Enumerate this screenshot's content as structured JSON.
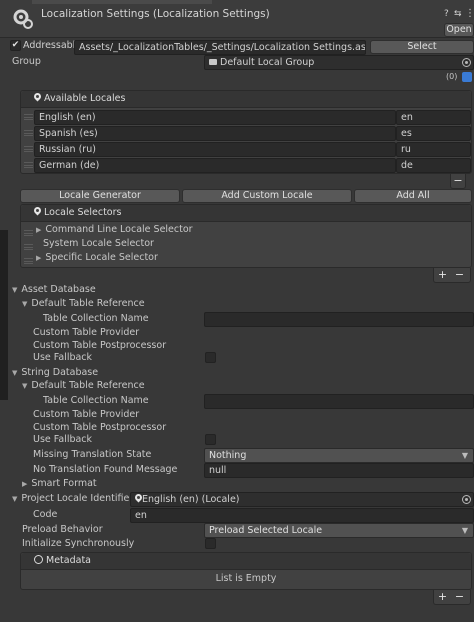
{
  "header": {
    "title": "Localization Settings (Localization Settings)",
    "open_button": "Open",
    "help_icon": "?",
    "preset_icon": "⇆",
    "menu_icon": "⋮"
  },
  "addressable": {
    "checkbox_label": "Addressable",
    "checked": true,
    "path": "Assets/_LocalizationTables/_Settings/Localization Settings.asset",
    "select_button": "Select"
  },
  "group": {
    "label": "Group",
    "value": "Default Local Group",
    "labels_count": "(0)"
  },
  "available_locales": {
    "title": "Available Locales",
    "items": [
      {
        "name": "English (en)",
        "code": "en"
      },
      {
        "name": "Spanish (es)",
        "code": "es"
      },
      {
        "name": "Russian (ru)",
        "code": "ru"
      },
      {
        "name": "German (de)",
        "code": "de"
      }
    ],
    "minus": "−"
  },
  "locale_buttons": {
    "generator": "Locale Generator",
    "add_custom": "Add Custom Locale",
    "add_all": "Add All"
  },
  "locale_selectors": {
    "title": "Locale Selectors",
    "items": [
      {
        "label": "Command Line Locale Selector",
        "foldout": true
      },
      {
        "label": "System Locale Selector",
        "foldout": false
      },
      {
        "label": "Specific Locale Selector",
        "foldout": true
      }
    ],
    "plus": "+",
    "minus": "−"
  },
  "asset_database": {
    "label": "Asset Database",
    "default_table_reference": "Default Table Reference",
    "table_collection_name": "Table Collection Name",
    "custom_table_provider": "Custom Table Provider",
    "custom_table_postprocessor": "Custom Table Postprocessor",
    "use_fallback": "Use Fallback"
  },
  "string_database": {
    "label": "String Database",
    "default_table_reference": "Default Table Reference",
    "table_collection_name": "Table Collection Name",
    "custom_table_provider": "Custom Table Provider",
    "custom_table_postprocessor": "Custom Table Postprocessor",
    "use_fallback": "Use Fallback",
    "missing_translation_state_label": "Missing Translation State",
    "missing_translation_state_value": "Nothing",
    "no_translation_message_label": "No Translation Found Message",
    "no_translation_message_value": "null",
    "smart_format": "Smart Format"
  },
  "project_locale": {
    "label": "Project Locale Identifier",
    "value": "English (en) (Locale)",
    "code_label": "Code",
    "code_value": "en"
  },
  "preload": {
    "label": "Preload Behavior",
    "value": "Preload Selected Locale"
  },
  "initialize_sync": {
    "label": "Initialize Synchronously"
  },
  "metadata": {
    "title": "Metadata",
    "empty_text": "List is Empty",
    "plus": "+",
    "minus": "−"
  },
  "colors": {
    "background": "#383838",
    "field": "#2a2a2a",
    "panel": "#414141",
    "text": "#c8c8c8"
  }
}
